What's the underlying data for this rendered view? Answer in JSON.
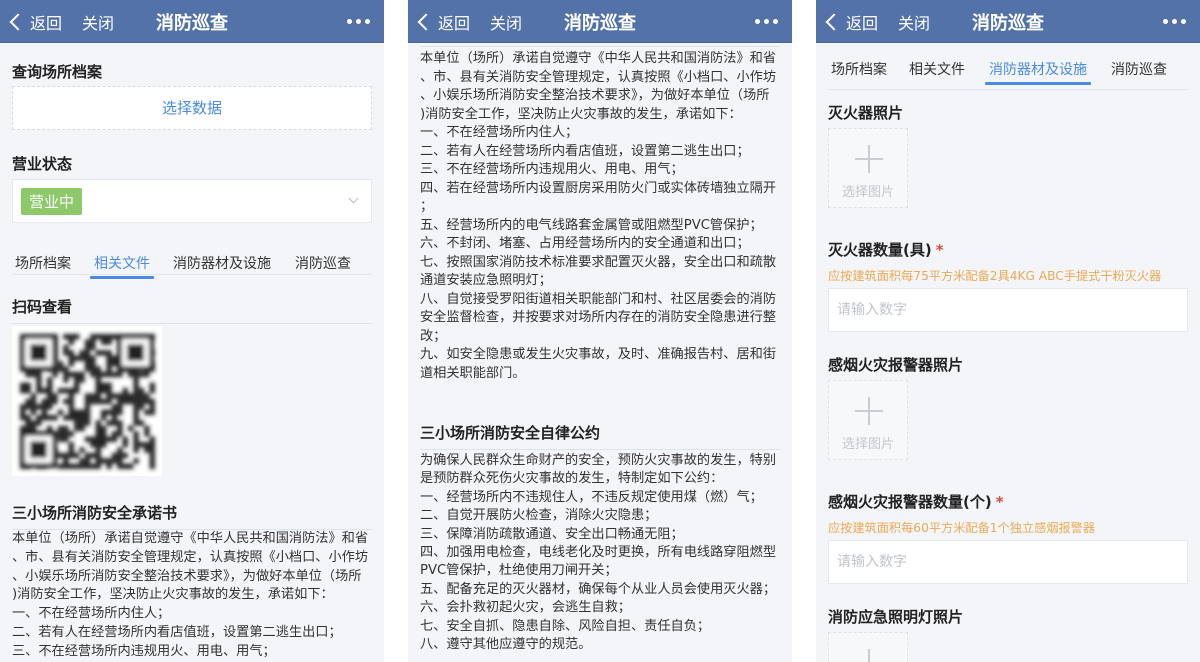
{
  "header": {
    "back": "返回",
    "close": "关闭",
    "title": "消防巡查"
  },
  "tabs": [
    "场所档案",
    "相关文件",
    "消防器材及设施",
    "消防巡查"
  ],
  "panel1": {
    "query_label": "查询场所档案",
    "select_data": "选择数据",
    "status_label": "营业状态",
    "status_value": "营业中",
    "scan_label": "扫码查看",
    "doc_title": "三小场所消防安全承诺书",
    "doc_lines": [
      "本单位（场所）承诺自觉遵守《中华人民共和国消防法》和省",
      "、市、县有关消防安全管理规定，认真按照《小档口、小作坊",
      "、小娱乐场所消防安全整治技术要求》，为做好本单位（场所",
      ")消防安全工作，坚决防止火灾事故的发生，承诺如下：",
      "一、不在经营场所内住人；",
      "二、若有人在经营场所内看店值班，设置第二逃生出口；",
      "三、不在经营场所内违规用火、用电、用气；"
    ]
  },
  "panel2": {
    "pledge_lines": [
      "本单位（场所）承诺自觉遵守《中华人民共和国消防法》和省",
      "、市、县有关消防安全管理规定，认真按照《小档口、小作坊",
      "、小娱乐场所消防安全整治技术要求》，为做好本单位（场所",
      ")消防安全工作，坚决防止火灾事故的发生，承诺如下：",
      "一、不在经营场所内住人；",
      "二、若有人在经营场所内看店值班，设置第二逃生出口；",
      "三、不在经营场所内违规用火、用电、用气；",
      "四、若在经营场所内设置厨房采用防火门或实体砖墙独立隔开",
      "；",
      "五、经营场所内的电气线路套金属管或阻燃型PVC管保护；",
      "六、不封闭、堵塞、占用经营场所内的安全通道和出口；",
      "七、按照国家消防技术标准要求配置灭火器，安全出口和疏散",
      "通道安装应急照明灯；",
      "八、自觉接受罗阳街道相关职能部门和村、社区居委会的消防",
      "安全监督检查，并按要求对场所内存在的消防安全隐患进行整",
      "改；",
      "九、如安全隐患或发生火灾事故，及时、准确报告村、居和街",
      "道相关职能部门。"
    ],
    "convention_title": "三小场所消防安全自律公约",
    "convention_lines": [
      "为确保人民群众生命财产的安全，预防火灾事故的发生，特别",
      "是预防群众死伤火灾事故的发生，特制定如下公约：",
      "一、经营场所内不违规住人，不违反规定使用煤（燃）气；",
      "二、自觉开展防火检查，消除火灾隐患；",
      "三、保障消防疏散通道、安全出口畅通无阻；",
      "四、加强用电检查，电线老化及时更换，所有电线路穿阻燃型",
      "PVC管保护，杜绝使用刀闸开关；",
      "五、配备充足的灭火器材，确保每个从业人员会使用灭火器；",
      "六、会扑救初起火灾，会逃生自救；",
      "七、安全自抓、隐患自除、风险自担、责任自负；",
      "八、遵守其他应遵守的规范。"
    ]
  },
  "panel3": {
    "extinguisher_photo": "灭火器照片",
    "select_image": "选择图片",
    "extinguisher_count": "灭火器数量(具)",
    "required": "*",
    "extinguisher_hint": "应按建筑面积每75平方米配备2具4KG ABC手提式干粉灭火器",
    "number_placeholder": "请输入数字",
    "smoke_photo": "感烟火灾报警器照片",
    "smoke_count": "感烟火灾报警器数量(个)",
    "smoke_hint": "应按建筑面积每60平方米配备1个独立感烟报警器",
    "light_photo": "消防应急照明灯照片"
  },
  "colors": {
    "header": "#5373a8",
    "accent": "#4a8be0",
    "status": "#8dc96a",
    "hint": "#eaaa55"
  }
}
